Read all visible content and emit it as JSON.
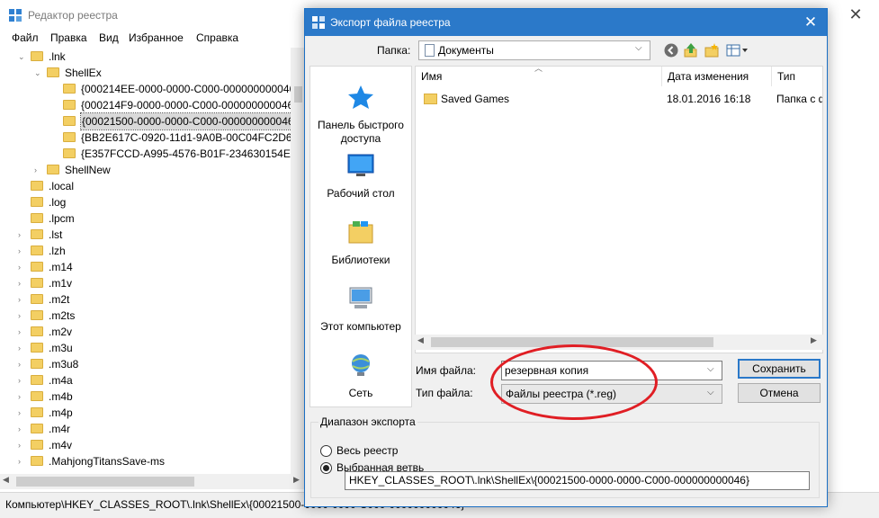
{
  "regedit": {
    "title": "Редактор реестра",
    "close_glyph": "✕",
    "menu": [
      "Файл",
      "Правка",
      "Вид",
      "Избранное",
      "Справка"
    ],
    "tree": [
      {
        "label": ".lnk",
        "expander": "⌄",
        "level": 1
      },
      {
        "label": "ShellEx",
        "expander": "⌄",
        "level": 2
      },
      {
        "label": "{000214EE-0000-0000-C000-000000000046}",
        "expander": "",
        "level": 3
      },
      {
        "label": "{000214F9-0000-0000-C000-000000000046}",
        "expander": "",
        "level": 3
      },
      {
        "label": "{00021500-0000-0000-C000-000000000046}",
        "expander": "",
        "level": 3,
        "selected": true
      },
      {
        "label": "{BB2E617C-0920-11d1-9A0B-00C04FC2D6C1}",
        "expander": "",
        "level": 3
      },
      {
        "label": "{E357FCCD-A995-4576-B01F-234630154E96}",
        "expander": "",
        "level": 3
      },
      {
        "label": "ShellNew",
        "expander": "›",
        "level": 2
      },
      {
        "label": ".local",
        "expander": "",
        "level": 1
      },
      {
        "label": ".log",
        "expander": "",
        "level": 1
      },
      {
        "label": ".lpcm",
        "expander": "",
        "level": 1
      },
      {
        "label": ".lst",
        "expander": "›",
        "level": 1
      },
      {
        "label": ".lzh",
        "expander": "›",
        "level": 1
      },
      {
        "label": ".m14",
        "expander": "›",
        "level": 1
      },
      {
        "label": ".m1v",
        "expander": "›",
        "level": 1
      },
      {
        "label": ".m2t",
        "expander": "›",
        "level": 1
      },
      {
        "label": ".m2ts",
        "expander": "›",
        "level": 1
      },
      {
        "label": ".m2v",
        "expander": "›",
        "level": 1
      },
      {
        "label": ".m3u",
        "expander": "›",
        "level": 1
      },
      {
        "label": ".m3u8",
        "expander": "›",
        "level": 1
      },
      {
        "label": ".m4a",
        "expander": "›",
        "level": 1
      },
      {
        "label": ".m4b",
        "expander": "›",
        "level": 1
      },
      {
        "label": ".m4p",
        "expander": "›",
        "level": 1
      },
      {
        "label": ".m4r",
        "expander": "›",
        "level": 1
      },
      {
        "label": ".m4v",
        "expander": "›",
        "level": 1
      },
      {
        "label": ".MahjongTitansSave-ms",
        "expander": "›",
        "level": 1
      }
    ],
    "status": "Компьютер\\HKEY_CLASSES_ROOT\\.lnk\\ShellEx\\{00021500-0000-0000-C000-000000000046}"
  },
  "dialog": {
    "title": "Экспорт файла реестра",
    "close_glyph": "✕",
    "folder_label": "Папка:",
    "folder_value": "Документы",
    "places": [
      {
        "label": "Панель быстрого доступа",
        "icon": "star-icon"
      },
      {
        "label": "Рабочий стол",
        "icon": "desktop-icon"
      },
      {
        "label": "Библиотеки",
        "icon": "libraries-icon"
      },
      {
        "label": "Этот компьютер",
        "icon": "computer-icon"
      },
      {
        "label": "Сеть",
        "icon": "network-icon"
      }
    ],
    "columns": [
      "Имя",
      "Дата изменения",
      "Тип"
    ],
    "files": [
      {
        "name": "Saved Games",
        "modified": "18.01.2016 16:18",
        "type": "Папка с ф"
      }
    ],
    "filename_label": "Имя файла:",
    "filename_value": "резервная копия",
    "filetype_label": "Тип файла:",
    "filetype_value": "Файлы реестра (*.reg)",
    "save_label": "Сохранить",
    "cancel_label": "Отмена",
    "range_legend": "Диапазон экспорта",
    "range_all": "Весь реестр",
    "range_branch": "Выбранная ветвь",
    "branch_value": "HKEY_CLASSES_ROOT\\.lnk\\ShellEx\\{00021500-0000-0000-C000-000000000046}",
    "accent_color": "#2b79c9",
    "annotation_color": "#e01e24"
  }
}
